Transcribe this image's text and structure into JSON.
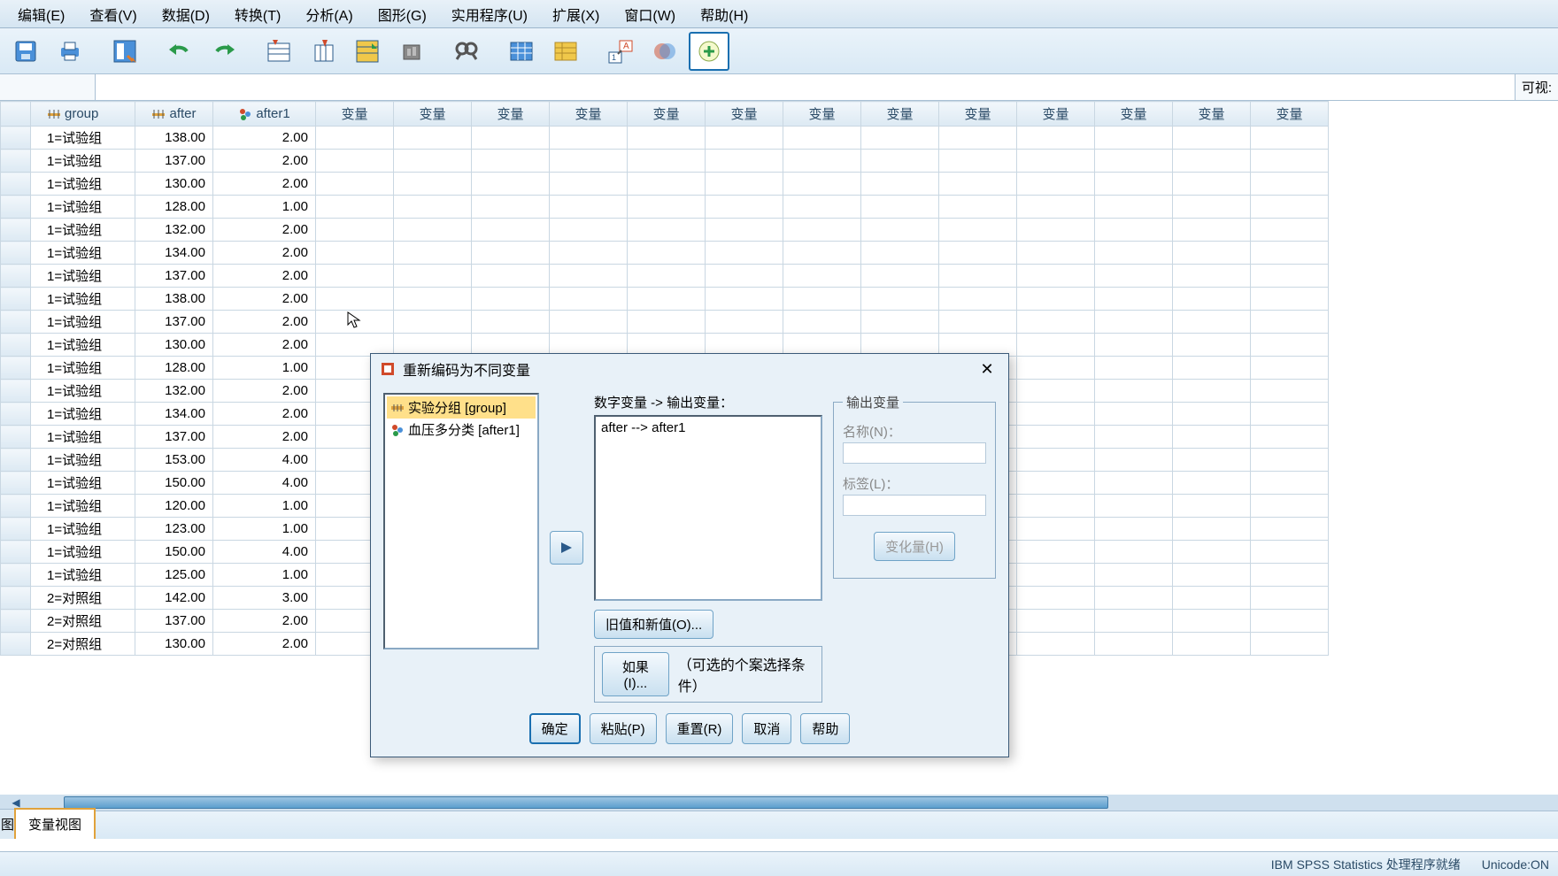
{
  "menu": [
    "编辑(E)",
    "查看(V)",
    "数据(D)",
    "转换(T)",
    "分析(A)",
    "图形(G)",
    "实用程序(U)",
    "扩展(X)",
    "窗口(W)",
    "帮助(H)"
  ],
  "toolbar_icons": [
    "save-icon",
    "print-icon",
    "sep",
    "goto-icon",
    "sep",
    "undo-icon",
    "redo-icon",
    "sep",
    "insert-case-icon",
    "insert-var-icon",
    "split-file-icon",
    "weight-icon",
    "sep",
    "find-icon",
    "sep",
    "value-labels-icon",
    "use-sets-icon",
    "sep",
    "show-labels-icon",
    "venn-icon",
    "add-icon"
  ],
  "formula_right": "可视:",
  "columns": {
    "group": "group",
    "after": "after",
    "after1": "after1",
    "blank": "变量"
  },
  "rows": [
    {
      "group": "1=试验组",
      "after": "138.00",
      "after1": "2.00"
    },
    {
      "group": "1=试验组",
      "after": "137.00",
      "after1": "2.00"
    },
    {
      "group": "1=试验组",
      "after": "130.00",
      "after1": "2.00"
    },
    {
      "group": "1=试验组",
      "after": "128.00",
      "after1": "1.00"
    },
    {
      "group": "1=试验组",
      "after": "132.00",
      "after1": "2.00"
    },
    {
      "group": "1=试验组",
      "after": "134.00",
      "after1": "2.00"
    },
    {
      "group": "1=试验组",
      "after": "137.00",
      "after1": "2.00"
    },
    {
      "group": "1=试验组",
      "after": "138.00",
      "after1": "2.00"
    },
    {
      "group": "1=试验组",
      "after": "137.00",
      "after1": "2.00"
    },
    {
      "group": "1=试验组",
      "after": "130.00",
      "after1": "2.00"
    },
    {
      "group": "1=试验组",
      "after": "128.00",
      "after1": "1.00"
    },
    {
      "group": "1=试验组",
      "after": "132.00",
      "after1": "2.00"
    },
    {
      "group": "1=试验组",
      "after": "134.00",
      "after1": "2.00"
    },
    {
      "group": "1=试验组",
      "after": "137.00",
      "after1": "2.00"
    },
    {
      "group": "1=试验组",
      "after": "153.00",
      "after1": "4.00"
    },
    {
      "group": "1=试验组",
      "after": "150.00",
      "after1": "4.00"
    },
    {
      "group": "1=试验组",
      "after": "120.00",
      "after1": "1.00"
    },
    {
      "group": "1=试验组",
      "after": "123.00",
      "after1": "1.00"
    },
    {
      "group": "1=试验组",
      "after": "150.00",
      "after1": "4.00"
    },
    {
      "group": "1=试验组",
      "after": "125.00",
      "after1": "1.00"
    },
    {
      "group": "2=对照组",
      "after": "142.00",
      "after1": "3.00"
    },
    {
      "group": "2=对照组",
      "after": "137.00",
      "after1": "2.00"
    },
    {
      "group": "2=对照组",
      "after": "130.00",
      "after1": "2.00"
    }
  ],
  "blank_cols": 13,
  "tabs": {
    "cut": "图",
    "variable_view": "变量视图"
  },
  "status": {
    "proc": "IBM SPSS Statistics 处理程序就绪",
    "unicode": "Unicode:ON"
  },
  "dialog": {
    "title": "重新编码为不同变量",
    "varlist": [
      {
        "icon": "ruler",
        "label": "实验分组 [group]",
        "selected": true
      },
      {
        "icon": "nominal",
        "label": "血压多分类 [after1]",
        "selected": false
      }
    ],
    "center_label": "数字变量 -> 输出变量：",
    "mapping": "after --> after1",
    "output_group": "输出变量",
    "name_label": "名称(N)：",
    "desc_label": "标签(L)：",
    "change_btn": "变化量(H)",
    "oldnew_btn": "旧值和新值(O)...",
    "if_btn": "如果(I)...",
    "if_text": "（可选的个案选择条件）",
    "buttons": {
      "ok": "确定",
      "paste": "粘贴(P)",
      "reset": "重置(R)",
      "cancel": "取消",
      "help": "帮助"
    }
  }
}
